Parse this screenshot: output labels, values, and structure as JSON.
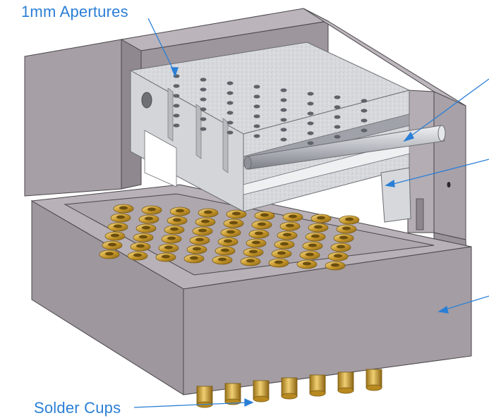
{
  "callouts": {
    "apertures": "1mm Apertures",
    "cups": "Solder Cups"
  },
  "colors": {
    "callout_text": "#2b7fd6",
    "housing_gray": "#a49ca3",
    "metal_silver": "#d9dbde",
    "gold": "#d4a93c"
  }
}
